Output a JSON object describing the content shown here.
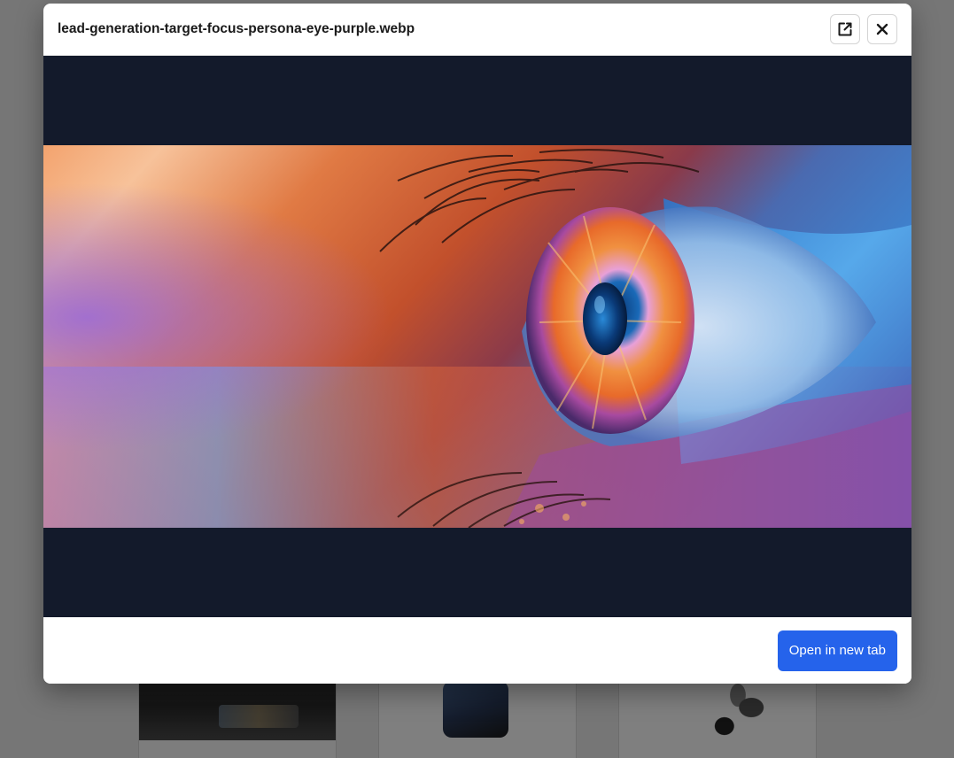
{
  "modal": {
    "title": "lead-generation-target-focus-persona-eye-purple.webp",
    "open_external_icon": "external-link-icon",
    "close_icon": "close-icon",
    "open_button_label": "Open in new tab"
  },
  "colors": {
    "preview_background": "#131a2b",
    "primary_button": "#2563eb",
    "overlay": "rgba(0,0,0,0.5)"
  }
}
